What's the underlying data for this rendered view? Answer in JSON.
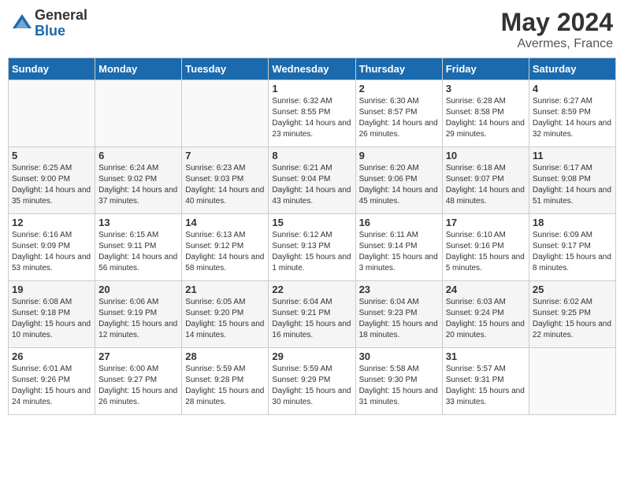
{
  "header": {
    "logo_general": "General",
    "logo_blue": "Blue",
    "month_year": "May 2024",
    "location": "Avermes, France"
  },
  "days_of_week": [
    "Sunday",
    "Monday",
    "Tuesday",
    "Wednesday",
    "Thursday",
    "Friday",
    "Saturday"
  ],
  "weeks": [
    [
      {
        "day": "",
        "sunrise": "",
        "sunset": "",
        "daylight": ""
      },
      {
        "day": "",
        "sunrise": "",
        "sunset": "",
        "daylight": ""
      },
      {
        "day": "",
        "sunrise": "",
        "sunset": "",
        "daylight": ""
      },
      {
        "day": "1",
        "sunrise": "Sunrise: 6:32 AM",
        "sunset": "Sunset: 8:55 PM",
        "daylight": "Daylight: 14 hours and 23 minutes."
      },
      {
        "day": "2",
        "sunrise": "Sunrise: 6:30 AM",
        "sunset": "Sunset: 8:57 PM",
        "daylight": "Daylight: 14 hours and 26 minutes."
      },
      {
        "day": "3",
        "sunrise": "Sunrise: 6:28 AM",
        "sunset": "Sunset: 8:58 PM",
        "daylight": "Daylight: 14 hours and 29 minutes."
      },
      {
        "day": "4",
        "sunrise": "Sunrise: 6:27 AM",
        "sunset": "Sunset: 8:59 PM",
        "daylight": "Daylight: 14 hours and 32 minutes."
      }
    ],
    [
      {
        "day": "5",
        "sunrise": "Sunrise: 6:25 AM",
        "sunset": "Sunset: 9:00 PM",
        "daylight": "Daylight: 14 hours and 35 minutes."
      },
      {
        "day": "6",
        "sunrise": "Sunrise: 6:24 AM",
        "sunset": "Sunset: 9:02 PM",
        "daylight": "Daylight: 14 hours and 37 minutes."
      },
      {
        "day": "7",
        "sunrise": "Sunrise: 6:23 AM",
        "sunset": "Sunset: 9:03 PM",
        "daylight": "Daylight: 14 hours and 40 minutes."
      },
      {
        "day": "8",
        "sunrise": "Sunrise: 6:21 AM",
        "sunset": "Sunset: 9:04 PM",
        "daylight": "Daylight: 14 hours and 43 minutes."
      },
      {
        "day": "9",
        "sunrise": "Sunrise: 6:20 AM",
        "sunset": "Sunset: 9:06 PM",
        "daylight": "Daylight: 14 hours and 45 minutes."
      },
      {
        "day": "10",
        "sunrise": "Sunrise: 6:18 AM",
        "sunset": "Sunset: 9:07 PM",
        "daylight": "Daylight: 14 hours and 48 minutes."
      },
      {
        "day": "11",
        "sunrise": "Sunrise: 6:17 AM",
        "sunset": "Sunset: 9:08 PM",
        "daylight": "Daylight: 14 hours and 51 minutes."
      }
    ],
    [
      {
        "day": "12",
        "sunrise": "Sunrise: 6:16 AM",
        "sunset": "Sunset: 9:09 PM",
        "daylight": "Daylight: 14 hours and 53 minutes."
      },
      {
        "day": "13",
        "sunrise": "Sunrise: 6:15 AM",
        "sunset": "Sunset: 9:11 PM",
        "daylight": "Daylight: 14 hours and 56 minutes."
      },
      {
        "day": "14",
        "sunrise": "Sunrise: 6:13 AM",
        "sunset": "Sunset: 9:12 PM",
        "daylight": "Daylight: 14 hours and 58 minutes."
      },
      {
        "day": "15",
        "sunrise": "Sunrise: 6:12 AM",
        "sunset": "Sunset: 9:13 PM",
        "daylight": "Daylight: 15 hours and 1 minute."
      },
      {
        "day": "16",
        "sunrise": "Sunrise: 6:11 AM",
        "sunset": "Sunset: 9:14 PM",
        "daylight": "Daylight: 15 hours and 3 minutes."
      },
      {
        "day": "17",
        "sunrise": "Sunrise: 6:10 AM",
        "sunset": "Sunset: 9:16 PM",
        "daylight": "Daylight: 15 hours and 5 minutes."
      },
      {
        "day": "18",
        "sunrise": "Sunrise: 6:09 AM",
        "sunset": "Sunset: 9:17 PM",
        "daylight": "Daylight: 15 hours and 8 minutes."
      }
    ],
    [
      {
        "day": "19",
        "sunrise": "Sunrise: 6:08 AM",
        "sunset": "Sunset: 9:18 PM",
        "daylight": "Daylight: 15 hours and 10 minutes."
      },
      {
        "day": "20",
        "sunrise": "Sunrise: 6:06 AM",
        "sunset": "Sunset: 9:19 PM",
        "daylight": "Daylight: 15 hours and 12 minutes."
      },
      {
        "day": "21",
        "sunrise": "Sunrise: 6:05 AM",
        "sunset": "Sunset: 9:20 PM",
        "daylight": "Daylight: 15 hours and 14 minutes."
      },
      {
        "day": "22",
        "sunrise": "Sunrise: 6:04 AM",
        "sunset": "Sunset: 9:21 PM",
        "daylight": "Daylight: 15 hours and 16 minutes."
      },
      {
        "day": "23",
        "sunrise": "Sunrise: 6:04 AM",
        "sunset": "Sunset: 9:23 PM",
        "daylight": "Daylight: 15 hours and 18 minutes."
      },
      {
        "day": "24",
        "sunrise": "Sunrise: 6:03 AM",
        "sunset": "Sunset: 9:24 PM",
        "daylight": "Daylight: 15 hours and 20 minutes."
      },
      {
        "day": "25",
        "sunrise": "Sunrise: 6:02 AM",
        "sunset": "Sunset: 9:25 PM",
        "daylight": "Daylight: 15 hours and 22 minutes."
      }
    ],
    [
      {
        "day": "26",
        "sunrise": "Sunrise: 6:01 AM",
        "sunset": "Sunset: 9:26 PM",
        "daylight": "Daylight: 15 hours and 24 minutes."
      },
      {
        "day": "27",
        "sunrise": "Sunrise: 6:00 AM",
        "sunset": "Sunset: 9:27 PM",
        "daylight": "Daylight: 15 hours and 26 minutes."
      },
      {
        "day": "28",
        "sunrise": "Sunrise: 5:59 AM",
        "sunset": "Sunset: 9:28 PM",
        "daylight": "Daylight: 15 hours and 28 minutes."
      },
      {
        "day": "29",
        "sunrise": "Sunrise: 5:59 AM",
        "sunset": "Sunset: 9:29 PM",
        "daylight": "Daylight: 15 hours and 30 minutes."
      },
      {
        "day": "30",
        "sunrise": "Sunrise: 5:58 AM",
        "sunset": "Sunset: 9:30 PM",
        "daylight": "Daylight: 15 hours and 31 minutes."
      },
      {
        "day": "31",
        "sunrise": "Sunrise: 5:57 AM",
        "sunset": "Sunset: 9:31 PM",
        "daylight": "Daylight: 15 hours and 33 minutes."
      },
      {
        "day": "",
        "sunrise": "",
        "sunset": "",
        "daylight": ""
      }
    ]
  ]
}
